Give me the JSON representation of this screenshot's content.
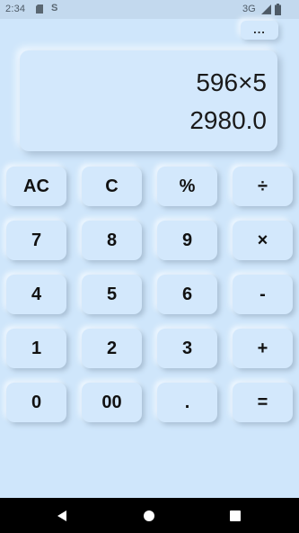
{
  "status_bar": {
    "time": "2:34",
    "sd_icon": "sd-card-icon",
    "s_icon_text": "S",
    "network": "3G",
    "signal_icon": "signal-icon",
    "battery_icon": "battery-icon"
  },
  "toolbar": {
    "more_label": "..."
  },
  "display": {
    "expression": "596×5",
    "result": "2980.0"
  },
  "keys": {
    "ac": "AC",
    "c": "C",
    "percent": "%",
    "divide": "÷",
    "seven": "7",
    "eight": "8",
    "nine": "9",
    "multiply": "×",
    "four": "4",
    "five": "5",
    "six": "6",
    "minus": "-",
    "one": "1",
    "two": "2",
    "three": "3",
    "plus": "+",
    "zero": "0",
    "double_zero": "00",
    "decimal": ".",
    "equals": "="
  },
  "nav_bar": {
    "back_icon": "back-icon",
    "home_icon": "home-icon",
    "recents_icon": "recents-icon"
  },
  "colors": {
    "background": "#cfe6fb",
    "key_surface": "#d3e8fc",
    "text": "#111111"
  }
}
